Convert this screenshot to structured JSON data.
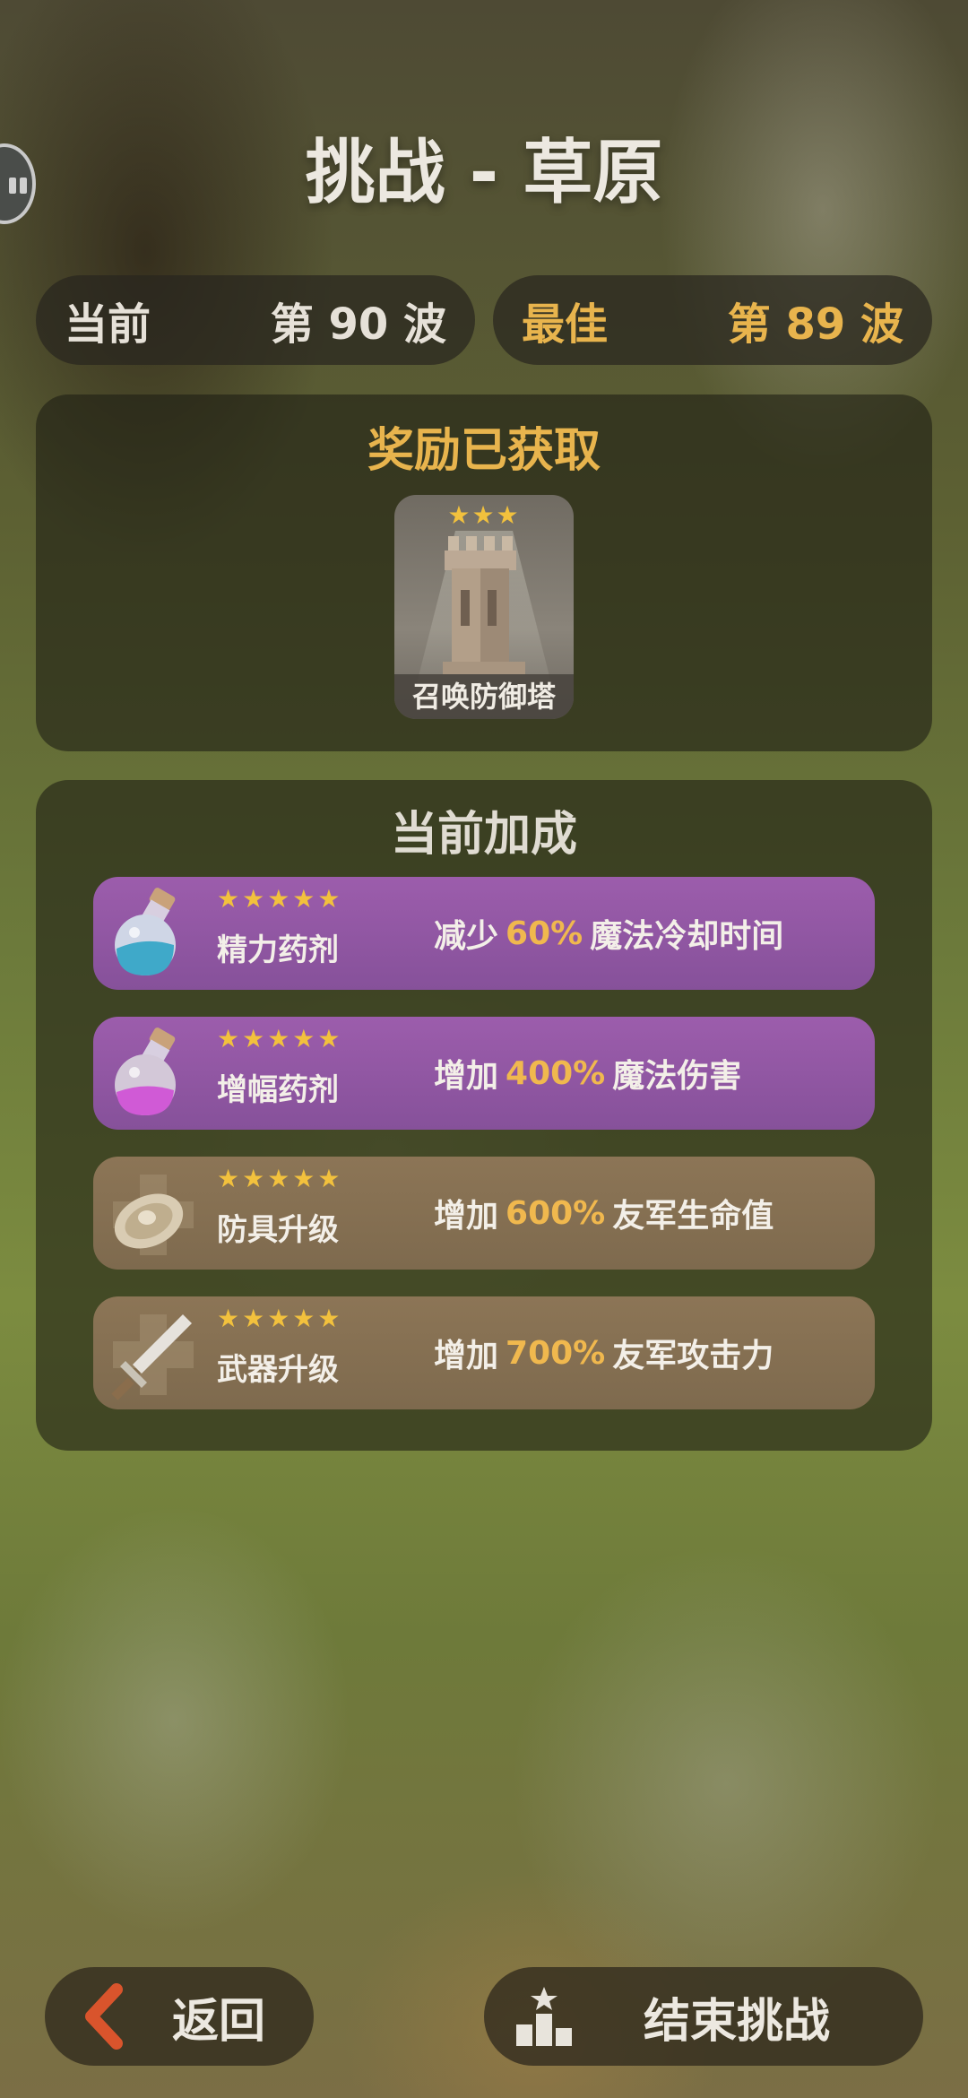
{
  "header": {
    "title": "挑战 - 草原"
  },
  "stats": {
    "current_label": "当前",
    "current_value": "第 90 波",
    "best_label": "最佳",
    "best_value": "第 89 波"
  },
  "reward": {
    "title": "奖励已获取",
    "item_label": "召唤防御塔",
    "stars": "★★★"
  },
  "bonus": {
    "title": "当前加成",
    "items": [
      {
        "stars": "★★★★★",
        "name": "精力药剂",
        "prefix": "减少",
        "value": "60%",
        "suffix": "魔法冷却时间",
        "icon": "blue-potion-icon"
      },
      {
        "stars": "★★★★★",
        "name": "增幅药剂",
        "prefix": "增加",
        "value": "400%",
        "suffix": "魔法伤害",
        "icon": "pink-potion-icon"
      },
      {
        "stars": "★★★★★",
        "name": "防具升级",
        "prefix": "增加",
        "value": "600%",
        "suffix": "友军生命值",
        "icon": "shield-upgrade-icon"
      },
      {
        "stars": "★★★★★",
        "name": "武器升级",
        "prefix": "增加",
        "value": "700%",
        "suffix": "友军攻击力",
        "icon": "sword-upgrade-icon"
      }
    ]
  },
  "footer": {
    "back_label": "返回",
    "end_label": "结束挑战"
  },
  "colors": {
    "accent_gold": "#e8b44d",
    "purple_row": "#9c5dac",
    "brown_row": "#8c7556",
    "back_arrow": "#d9542c"
  }
}
